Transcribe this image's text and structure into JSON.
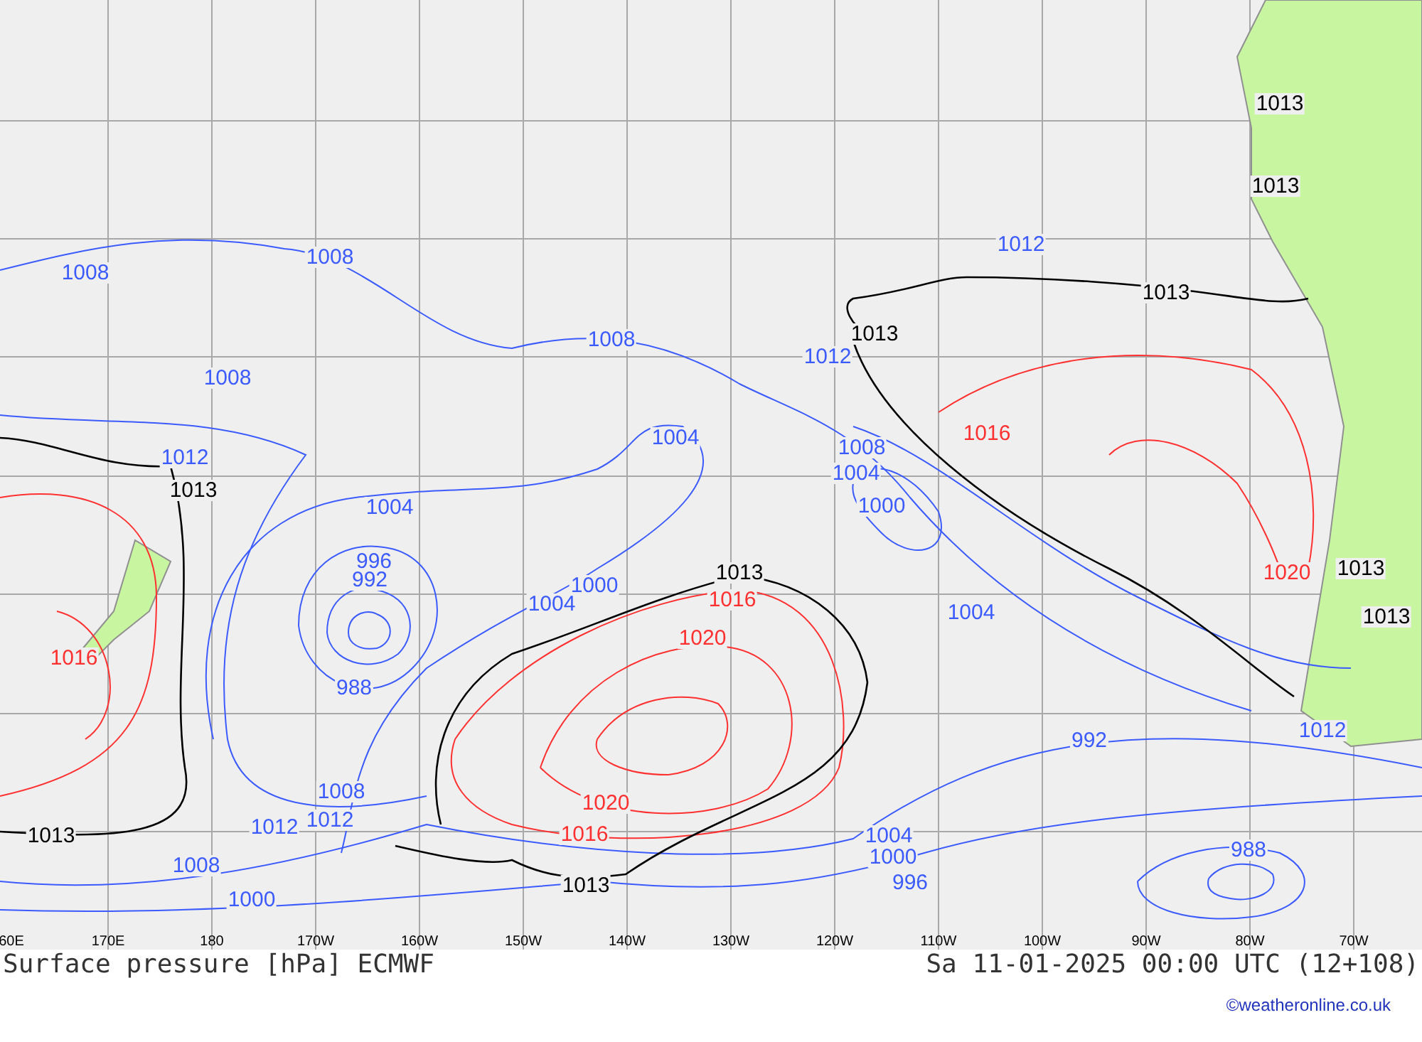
{
  "map": {
    "isobar_labels": [
      {
        "text": "1013",
        "color": "#000000"
      },
      {
        "text": "1013",
        "color": "#000000"
      },
      {
        "text": "1012",
        "color": "#3b5bff"
      },
      {
        "text": "1008",
        "color": "#3b5bff"
      },
      {
        "text": "1008",
        "color": "#3b5bff"
      },
      {
        "text": "1013",
        "color": "#000000"
      },
      {
        "text": "1013",
        "color": "#000000"
      },
      {
        "text": "1008",
        "color": "#3b5bff"
      },
      {
        "text": "1012",
        "color": "#3b5bff"
      },
      {
        "text": "1008",
        "color": "#3b5bff"
      },
      {
        "text": "1016",
        "color": "#ff3030"
      },
      {
        "text": "1004",
        "color": "#3b5bff"
      },
      {
        "text": "1008",
        "color": "#3b5bff"
      },
      {
        "text": "1012",
        "color": "#3b5bff"
      },
      {
        "text": "1004",
        "color": "#3b5bff"
      },
      {
        "text": "1013",
        "color": "#000000"
      },
      {
        "text": "1000",
        "color": "#3b5bff"
      },
      {
        "text": "1004",
        "color": "#3b5bff"
      },
      {
        "text": "996",
        "color": "#3b5bff"
      },
      {
        "text": "1013",
        "color": "#000000"
      },
      {
        "text": "1020",
        "color": "#ff3030"
      },
      {
        "text": "1013",
        "color": "#000000"
      },
      {
        "text": "992",
        "color": "#3b5bff"
      },
      {
        "text": "1000",
        "color": "#3b5bff"
      },
      {
        "text": "1016",
        "color": "#ff3030"
      },
      {
        "text": "1004",
        "color": "#3b5bff"
      },
      {
        "text": "1004",
        "color": "#3b5bff"
      },
      {
        "text": "1013",
        "color": "#000000"
      },
      {
        "text": "1020",
        "color": "#ff3030"
      },
      {
        "text": "1016",
        "color": "#ff3030"
      },
      {
        "text": "988",
        "color": "#3b5bff"
      },
      {
        "text": "1012",
        "color": "#3b5bff"
      },
      {
        "text": "992",
        "color": "#3b5bff"
      },
      {
        "text": "1008",
        "color": "#3b5bff"
      },
      {
        "text": "1020",
        "color": "#ff3030"
      },
      {
        "text": "1012",
        "color": "#3b5bff"
      },
      {
        "text": "1012",
        "color": "#3b5bff"
      },
      {
        "text": "1013",
        "color": "#000000"
      },
      {
        "text": "1016",
        "color": "#ff3030"
      },
      {
        "text": "1004",
        "color": "#3b5bff"
      },
      {
        "text": "988",
        "color": "#3b5bff"
      },
      {
        "text": "1000",
        "color": "#3b5bff"
      },
      {
        "text": "1008",
        "color": "#3b5bff"
      },
      {
        "text": "996",
        "color": "#3b5bff"
      },
      {
        "text": "1013",
        "color": "#000000"
      },
      {
        "text": "1000",
        "color": "#3b5bff"
      }
    ],
    "longitudes": [
      "60E",
      "170E",
      "180",
      "170W",
      "160W",
      "150W",
      "140W",
      "130W",
      "120W",
      "110W",
      "100W",
      "90W",
      "80W",
      "70W"
    ]
  },
  "title": "Surface pressure [hPa] ECMWF",
  "valid_time": "Sa 11-01-2025 00:00 UTC (12+108)",
  "credit": "©weatheronline.co.uk"
}
